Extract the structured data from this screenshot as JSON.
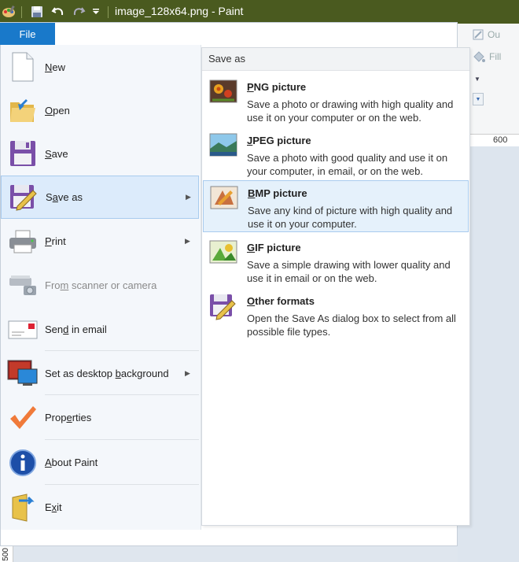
{
  "window": {
    "title": "image_128x64.png - Paint"
  },
  "file_tab": {
    "label": "File"
  },
  "ribbon": {
    "outline_label": "Ou",
    "fill_label": "Fill",
    "ruler_mark": "600",
    "vruler_mark": "500"
  },
  "menu": {
    "items": [
      {
        "label": "New",
        "hotkey": "N"
      },
      {
        "label": "Open",
        "hotkey": "O"
      },
      {
        "label": "Save",
        "hotkey": "S"
      },
      {
        "label": "Save as",
        "hotkey": "a"
      },
      {
        "label": "Print",
        "hotkey": "P"
      },
      {
        "label": "From scanner or camera",
        "hotkey": "m"
      },
      {
        "label": "Send in email",
        "hotkey": "d"
      },
      {
        "label": "Set as desktop background",
        "hotkey": "b"
      },
      {
        "label": "Properties",
        "hotkey": "e"
      },
      {
        "label": "About Paint",
        "hotkey": "A"
      },
      {
        "label": "Exit",
        "hotkey": "x"
      }
    ]
  },
  "saveas": {
    "header": "Save as",
    "items": [
      {
        "title": "PNG picture",
        "desc": "Save a photo or drawing with high quality and use it on your computer or on the web."
      },
      {
        "title": "JPEG picture",
        "desc": "Save a photo with good quality and use it on your computer, in email, or on the web."
      },
      {
        "title": "BMP picture",
        "desc": "Save any kind of picture with high quality and use it on your computer."
      },
      {
        "title": "GIF picture",
        "desc": "Save a simple drawing with lower quality and use it in email or on the web."
      },
      {
        "title": "Other formats",
        "desc": "Open the Save As dialog box to select from all possible file types."
      }
    ]
  }
}
